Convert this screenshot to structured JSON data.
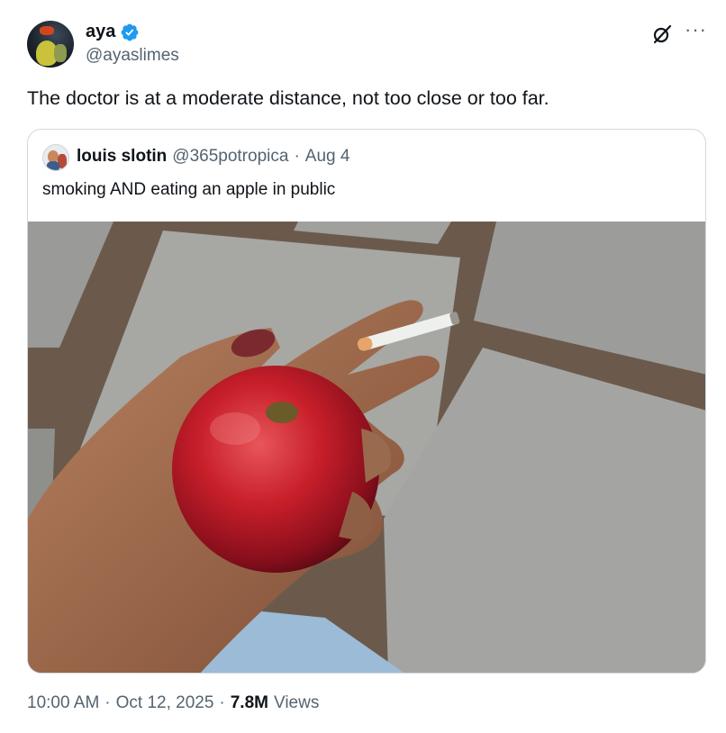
{
  "author": {
    "display_name": "aya",
    "handle": "@ayaslimes",
    "verified_color": "#1d9bf0",
    "avatar_icon": "avatar-image"
  },
  "tweet": {
    "text": "The doctor is at a moderate distance, not too close or too far."
  },
  "quoted": {
    "display_name": "louis slotin",
    "handle": "@365potropica",
    "separator": "·",
    "date": "Aug 4",
    "text": "smoking AND eating an apple in public",
    "image_alt_icon": "photo-hand-apple-cigarette"
  },
  "meta": {
    "time": "10:00 AM",
    "sep1": "·",
    "date": "Oct 12, 2025",
    "sep2": "·",
    "views_count": "7.8M",
    "views_label": "Views"
  },
  "icons": {
    "grok": "grok-icon",
    "more": "more-icon"
  }
}
